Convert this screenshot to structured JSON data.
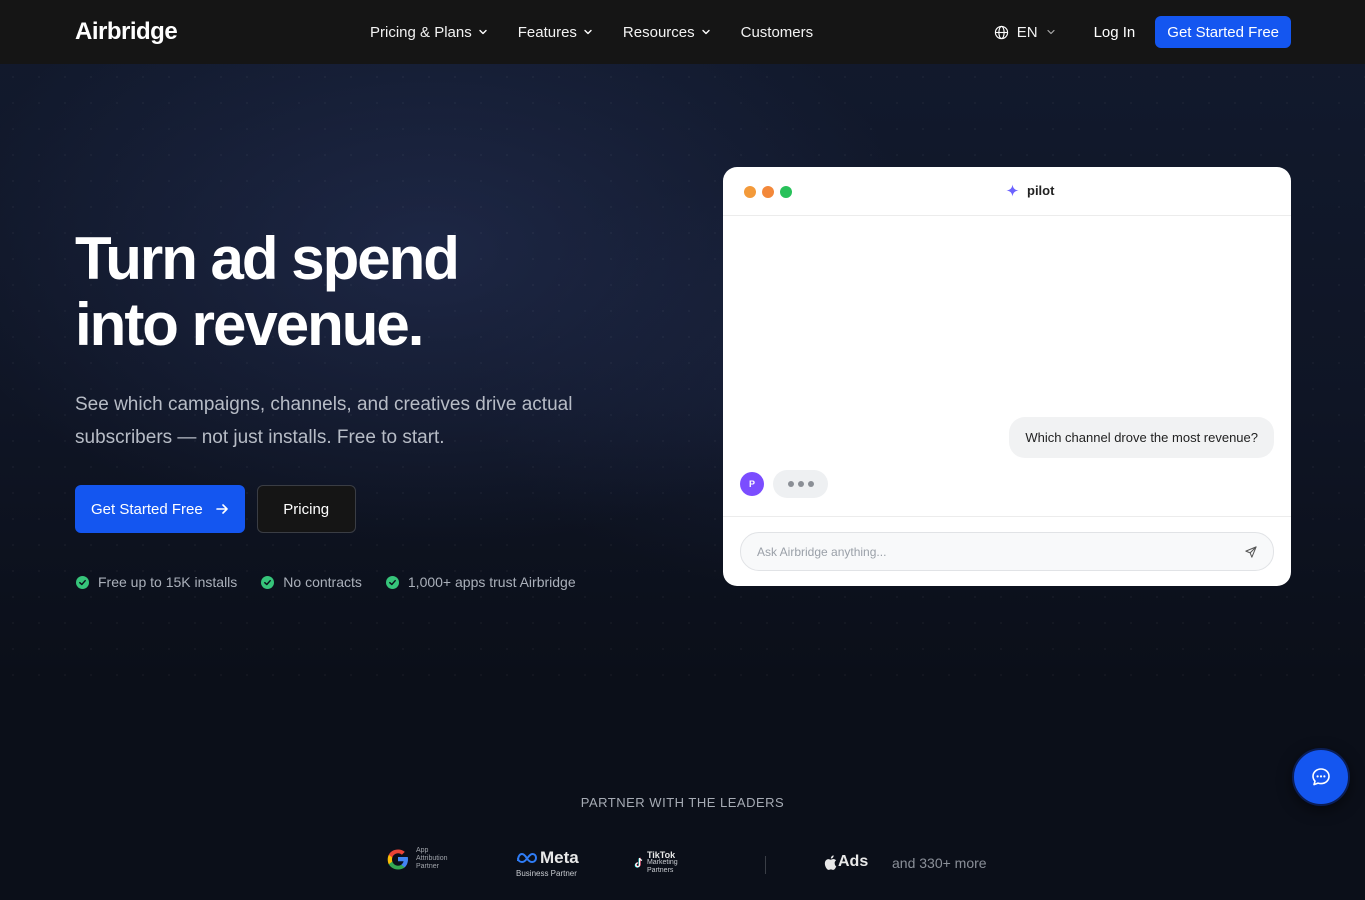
{
  "header": {
    "logo": "Airbridge",
    "nav": [
      {
        "label": "Pricing & Plans",
        "has_dropdown": true
      },
      {
        "label": "Features",
        "has_dropdown": true
      },
      {
        "label": "Resources",
        "has_dropdown": true
      },
      {
        "label": "Customers",
        "has_dropdown": false
      }
    ],
    "language": "EN",
    "login": "Log In",
    "cta": "Get Started Free"
  },
  "hero": {
    "title_line1": "Turn ad spend",
    "title_line2": "into revenue.",
    "subtitle": "See which campaigns, channels, and creatives drive actual subscribers — not just installs. Free to start.",
    "primary_cta": "Get Started Free",
    "secondary_cta": "Pricing",
    "checks": [
      "Free up to 15K installs",
      "No contracts",
      "1,000+ apps trust Airbridge"
    ]
  },
  "chat": {
    "title": "pilot",
    "user_message": "Which channel drove the most revenue?",
    "bot_avatar": "P",
    "input_placeholder": "Ask Airbridge anything..."
  },
  "partners": {
    "title": "PARTNER WITH THE LEADERS",
    "google_line1": "App",
    "google_line2": "Attribution",
    "google_line3": "Partner",
    "meta_name": "Meta",
    "meta_sub": "Business Partner",
    "tiktok_name": "TikTok",
    "tiktok_sub": "Marketing Partners",
    "apple_ads": "Ads",
    "more": "and 330+ more"
  },
  "colors": {
    "accent": "#1456f0",
    "header_bg": "#151515",
    "page_bg": "#0b0f19",
    "check_green": "#36c47a",
    "bot_avatar": "#7b4dff"
  }
}
